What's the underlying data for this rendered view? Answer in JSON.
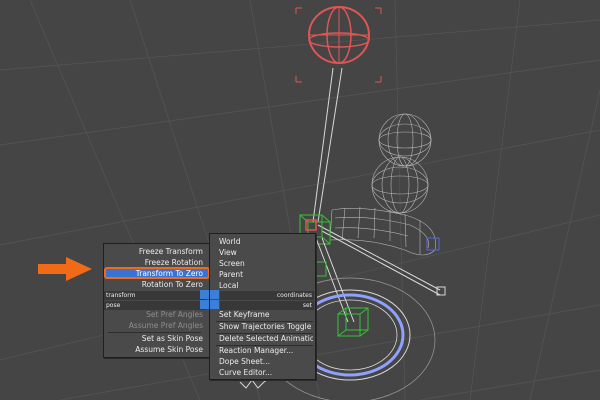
{
  "quad_menu": {
    "left": {
      "items": [
        {
          "label": "Freeze Transform",
          "state": "normal"
        },
        {
          "label": "Freeze Rotation",
          "state": "normal"
        },
        {
          "label": "Transform To Zero",
          "state": "highlighted"
        },
        {
          "label": "Rotation To Zero",
          "state": "normal"
        },
        {
          "label": "Set Pref Angles",
          "state": "disabled"
        },
        {
          "label": "Assume Pref Angles",
          "state": "disabled"
        },
        {
          "label": "Set as Skin Pose",
          "state": "normal"
        },
        {
          "label": "Assume Skin Pose",
          "state": "normal"
        }
      ],
      "quadrant_labels": {
        "transform": "transform",
        "pose": "pose"
      }
    },
    "right": {
      "items": [
        {
          "label": "World"
        },
        {
          "label": "View"
        },
        {
          "label": "Screen"
        },
        {
          "label": "Parent"
        },
        {
          "label": "Local"
        },
        {
          "label": "Set Keyframe"
        },
        {
          "label": "Show Trajectories Toggle"
        },
        {
          "label": "Delete Selected Animation"
        },
        {
          "label": "Reaction Manager..."
        },
        {
          "label": "Dope Sheet..."
        },
        {
          "label": "Curve Editor..."
        }
      ],
      "quadrant_labels": {
        "coordinates": "coordinates",
        "set": "set"
      }
    }
  },
  "colors": {
    "viewport_bg": "#454545",
    "grid": "#5a5a5a",
    "selection_red": "#e05555",
    "wire_white": "#d8d8d8",
    "wire_gray": "#b4b4b4",
    "bone_green": "#35c235",
    "highlight_blue": "#3a72d4",
    "annotation_orange": "#f06a18",
    "disc_blue": "#8fa0ff"
  },
  "icons": {
    "annotation_arrow": "arrow-right-icon",
    "center_box": "quad-center-icon"
  }
}
